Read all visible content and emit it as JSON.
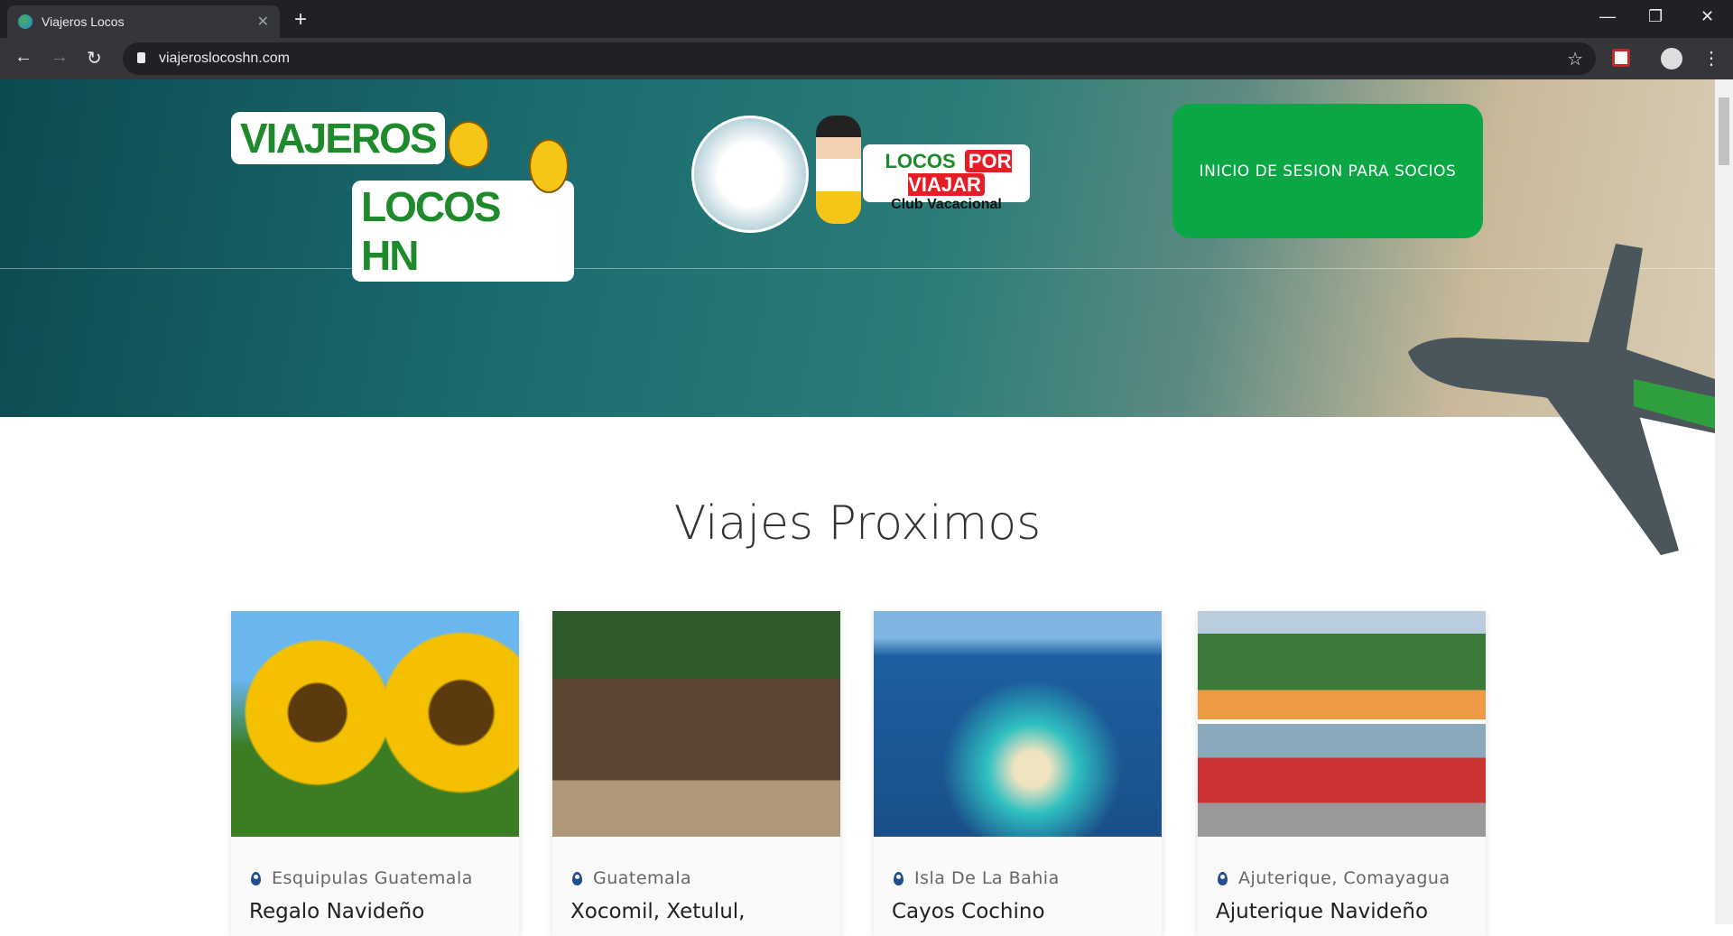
{
  "browser": {
    "tab_title": "Viajeros Locos",
    "url": "viajeroslocoshn.com"
  },
  "header": {
    "logo_line1": "VIAJEROS",
    "logo_line2": "LOCOS HN",
    "club_logo_main": "LOCOS",
    "club_logo_accent": "POR VIAJAR",
    "club_logo_sub": "Club Vacacional",
    "login_button": "INICIO DE SESION PARA SOCIOS"
  },
  "section": {
    "title": "Viajes Proximos"
  },
  "trips": [
    {
      "location": "Esquipulas Guatemala",
      "name": "Regalo Navideño"
    },
    {
      "location": "Guatemala",
      "name": "Xocomil, Xetulul,"
    },
    {
      "location": "Isla De La Bahia",
      "name": "Cayos Cochino"
    },
    {
      "location": "Ajuterique, Comayagua",
      "name": "Ajuterique Navideño"
    }
  ],
  "colors": {
    "accent_green": "#0aa744",
    "pin_blue": "#1f4e8c"
  }
}
